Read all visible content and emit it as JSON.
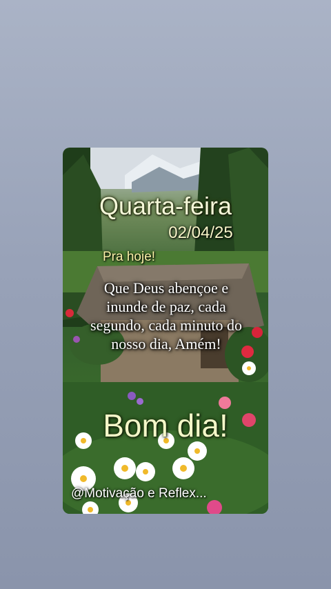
{
  "post": {
    "weekday": "Quarta-feira",
    "date": "02/04/25",
    "intro": "Pra hoje!",
    "prayer": "Que Deus abençoe e inunde de paz, cada segundo, cada minuto do nosso dia, Amém!",
    "greeting": "Bom dia!",
    "watermark": "@Motivação e Reflex..."
  },
  "colors": {
    "background": "#98a2b8",
    "title_text": "#f4f7d8",
    "accent_text": "#fbf1a8"
  }
}
